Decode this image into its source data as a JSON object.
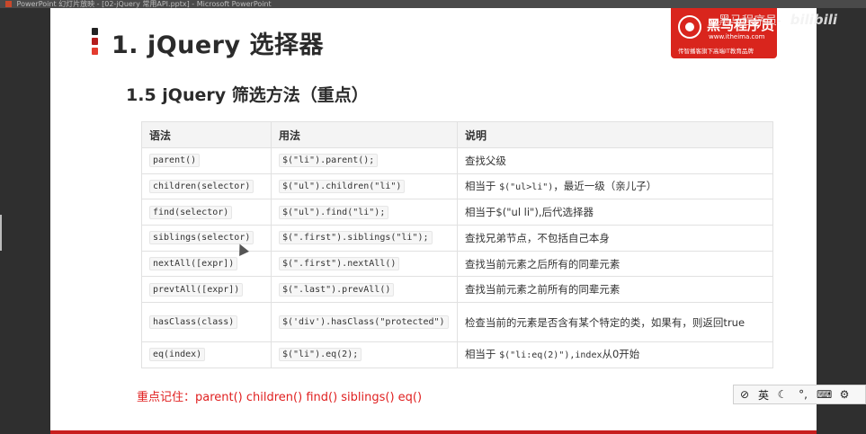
{
  "window": {
    "title": "PowerPoint 幻灯片放映 - [02-jQuery 常用API.pptx] - Microsoft PowerPoint"
  },
  "slide": {
    "main_title": "1. jQuery 选择器",
    "sub_title": "1.5  jQuery 筛选方法（重点）",
    "table": {
      "headers": [
        "语法",
        "用法",
        "说明"
      ],
      "rows": [
        {
          "syntax": "parent()",
          "usage": "$(\"li\").parent();",
          "desc": "查找父级"
        },
        {
          "syntax": "children(selector)",
          "usage": "$(\"ul\").children(\"li\")",
          "desc_pre": "相当于",
          "desc_code": "$(\"ul>li\")",
          "desc_post": "，最近一级（亲儿子）"
        },
        {
          "syntax": "find(selector)",
          "usage": "$(\"ul\").find(\"li\");",
          "desc": "相当于$(\"ul li\"),后代选择器"
        },
        {
          "syntax": "siblings(selector)",
          "usage": "$(\".first\").siblings(\"li\");",
          "desc": "查找兄弟节点，不包括自己本身"
        },
        {
          "syntax": "nextAll([expr])",
          "usage": "$(\".first\").nextAll()",
          "desc": "查找当前元素之后所有的同辈元素"
        },
        {
          "syntax": "prevtAll([expr])",
          "usage": "$(\".last\").prevAll()",
          "desc": "查找当前元素之前所有的同辈元素"
        },
        {
          "syntax": "hasClass(class)",
          "usage": "$('div').hasClass(\"protected\")",
          "desc": "检查当前的元素是否含有某个特定的类，如果有，则返回true"
        },
        {
          "syntax": "eq(index)",
          "usage": "$(\"li\").eq(2);",
          "desc_pre": "相当于",
          "desc_code": "$(\"li:eq(2)\"),index",
          "desc_post": "从0开始"
        }
      ]
    },
    "memo": "重点记住：parent()  children()  find()  siblings()  eq()"
  },
  "logo": {
    "name": "黑马程序员",
    "url": "www.itheima.com",
    "tagline": "传智播客旗下高端IT教育品牌"
  },
  "watermark": {
    "text": "黑马程序员-",
    "brand": "bilibili"
  },
  "ime": {
    "lang": "英",
    "icons": [
      "ime-logo-icon",
      "moon-icon",
      "punctuation-icon",
      "keyboard-icon",
      "gear-icon"
    ]
  },
  "colors": {
    "accent_red": "#d9251d",
    "memo_red": "#e02020"
  }
}
